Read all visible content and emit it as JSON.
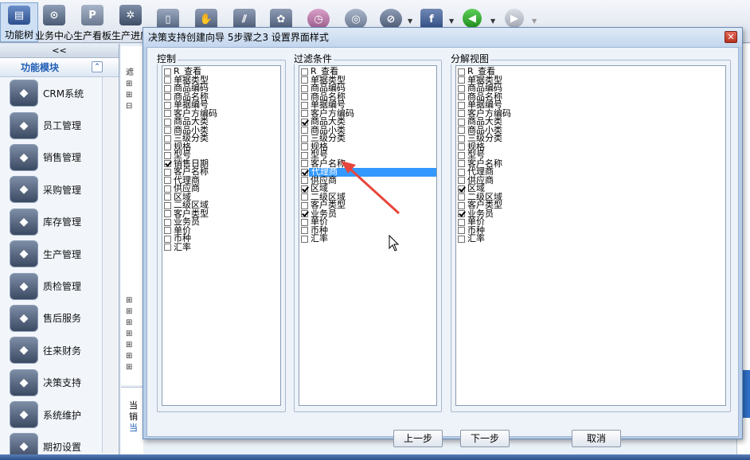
{
  "toolbar": {
    "buttons": [
      {
        "label": "功能树",
        "icon": "function-tree-icon"
      },
      {
        "label": "业务中心",
        "icon": "business-center-icon"
      },
      {
        "label": "生产看板",
        "icon": "production-board-icon"
      },
      {
        "label": "生产进度",
        "icon": "production-progress-icon"
      }
    ],
    "accent": "#1f5eb5"
  },
  "left_panel": {
    "top_label": "<<",
    "title": "功能模块",
    "modules": [
      {
        "label": "CRM系统",
        "icon": "crm-icon"
      },
      {
        "label": "员工管理",
        "icon": "employee-icon"
      },
      {
        "label": "销售管理",
        "icon": "sales-icon"
      },
      {
        "label": "采购管理",
        "icon": "purchase-icon"
      },
      {
        "label": "库存管理",
        "icon": "inventory-icon"
      },
      {
        "label": "生产管理",
        "icon": "production-icon"
      },
      {
        "label": "质检管理",
        "icon": "quality-icon"
      },
      {
        "label": "售后服务",
        "icon": "after-sales-icon"
      },
      {
        "label": "往来财务",
        "icon": "finance-icon"
      },
      {
        "label": "决策支持",
        "icon": "decision-icon"
      },
      {
        "label": "系统维护",
        "icon": "maintenance-icon"
      },
      {
        "label": "期初设置",
        "icon": "opening-setup-icon"
      }
    ]
  },
  "dialog": {
    "title": "决策支持创建向导  5步骤之3  设置界面样式",
    "groups": [
      {
        "title": "控制",
        "items": [
          {
            "label": "R_查看",
            "checked": false
          },
          {
            "label": "单据类型",
            "checked": false
          },
          {
            "label": "商品编码",
            "checked": false
          },
          {
            "label": "商品名称",
            "checked": false
          },
          {
            "label": "单据编号",
            "checked": false
          },
          {
            "label": "客户方编码",
            "checked": false
          },
          {
            "label": "商品大类",
            "checked": false
          },
          {
            "label": "商品小类",
            "checked": false
          },
          {
            "label": "三级分类",
            "checked": false
          },
          {
            "label": "规格",
            "checked": false
          },
          {
            "label": "型号",
            "checked": false
          },
          {
            "label": "销售日期",
            "checked": true
          },
          {
            "label": "客户名称",
            "checked": false
          },
          {
            "label": "代理商",
            "checked": false
          },
          {
            "label": "供应商",
            "checked": false
          },
          {
            "label": "区域",
            "checked": false
          },
          {
            "label": "二级区域",
            "checked": false
          },
          {
            "label": "客户类型",
            "checked": false
          },
          {
            "label": "业务员",
            "checked": false
          },
          {
            "label": "单价",
            "checked": false
          },
          {
            "label": "币种",
            "checked": false
          },
          {
            "label": "汇率",
            "checked": false
          }
        ]
      },
      {
        "title": "过滤条件",
        "selected_index": 12,
        "items": [
          {
            "label": "R_查看",
            "checked": false
          },
          {
            "label": "单据类型",
            "checked": false
          },
          {
            "label": "商品编码",
            "checked": false
          },
          {
            "label": "商品名称",
            "checked": false
          },
          {
            "label": "单据编号",
            "checked": false
          },
          {
            "label": "客户方编码",
            "checked": false
          },
          {
            "label": "商品大类",
            "checked": true
          },
          {
            "label": "商品小类",
            "checked": false
          },
          {
            "label": "三级分类",
            "checked": false
          },
          {
            "label": "规格",
            "checked": false
          },
          {
            "label": "型号",
            "checked": false
          },
          {
            "label": "客户名称",
            "checked": false
          },
          {
            "label": "代理商",
            "checked": true
          },
          {
            "label": "供应商",
            "checked": false
          },
          {
            "label": "区域",
            "checked": true
          },
          {
            "label": "二级区域",
            "checked": false
          },
          {
            "label": "客户类型",
            "checked": false
          },
          {
            "label": "业务员",
            "checked": true
          },
          {
            "label": "单价",
            "checked": false
          },
          {
            "label": "币种",
            "checked": false
          },
          {
            "label": "汇率",
            "checked": false
          }
        ]
      },
      {
        "title": "分解视图",
        "items": [
          {
            "label": "R_查看",
            "checked": false
          },
          {
            "label": "单据类型",
            "checked": false
          },
          {
            "label": "商品编码",
            "checked": false
          },
          {
            "label": "商品名称",
            "checked": false
          },
          {
            "label": "单据编号",
            "checked": false
          },
          {
            "label": "客户方编码",
            "checked": false
          },
          {
            "label": "商品大类",
            "checked": false
          },
          {
            "label": "商品小类",
            "checked": false
          },
          {
            "label": "三级分类",
            "checked": false
          },
          {
            "label": "规格",
            "checked": false
          },
          {
            "label": "型号",
            "checked": false
          },
          {
            "label": "客户名称",
            "checked": false
          },
          {
            "label": "代理商",
            "checked": false
          },
          {
            "label": "供应商",
            "checked": false
          },
          {
            "label": "区域",
            "checked": true
          },
          {
            "label": "二级区域",
            "checked": false
          },
          {
            "label": "客户类型",
            "checked": false
          },
          {
            "label": "业务员",
            "checked": true
          },
          {
            "label": "单价",
            "checked": false
          },
          {
            "label": "币种",
            "checked": false
          },
          {
            "label": "汇率",
            "checked": false
          }
        ]
      }
    ],
    "buttons": {
      "prev": "上一步",
      "next": "下一步",
      "cancel": "取消"
    },
    "annotation_color": "#e8453c",
    "selection_color": "#3399ff"
  },
  "background": {
    "tree_stub": "遮",
    "bottom_text_1": "当",
    "bottom_text_2": "销",
    "bottom_text_3": "当"
  }
}
